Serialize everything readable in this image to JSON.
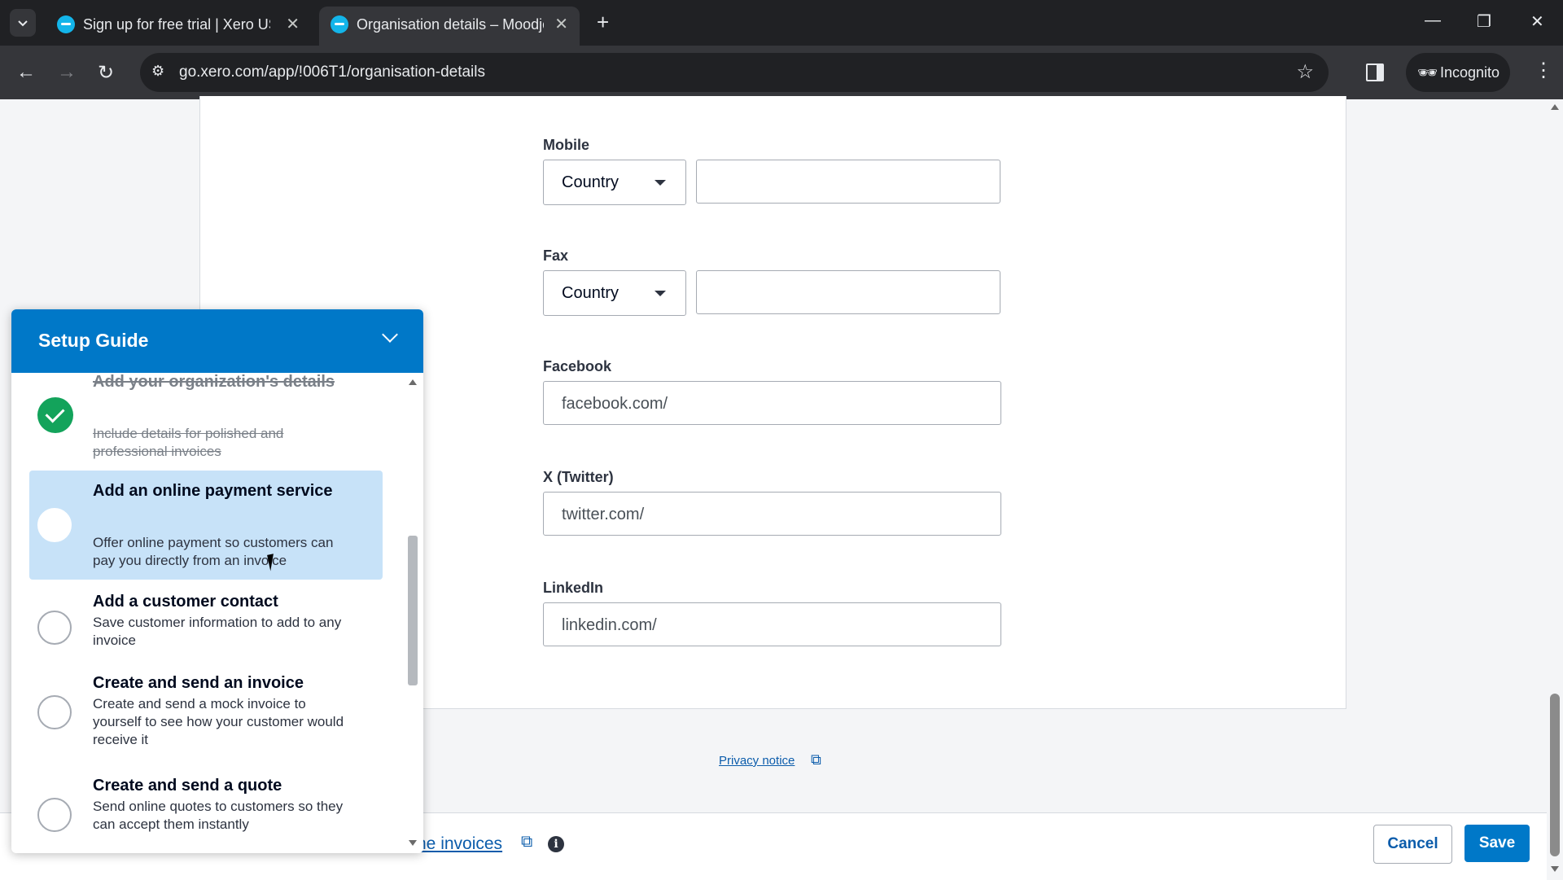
{
  "browser": {
    "tabs": [
      {
        "title": "Sign up for free trial | Xero US",
        "active": false
      },
      {
        "title": "Organisation details – Moodjoy",
        "active": true
      }
    ],
    "url": "go.xero.com/app/!006T1/organisation-details",
    "incognito_label": "Incognito"
  },
  "form": {
    "mobile": {
      "label": "Mobile",
      "country_placeholder": "Country",
      "value": ""
    },
    "fax": {
      "label": "Fax",
      "country_placeholder": "Country",
      "value": ""
    },
    "facebook": {
      "label": "Facebook",
      "value": "facebook.com/"
    },
    "twitter": {
      "label": "X (Twitter)",
      "value": "twitter.com/"
    },
    "linkedin": {
      "label": "LinkedIn",
      "value": "linkedin.com/"
    },
    "privacy_link": "Privacy notice"
  },
  "footer": {
    "online_invoices_link": "ne invoices",
    "cancel_label": "Cancel",
    "save_label": "Save"
  },
  "setup_guide": {
    "title": "Setup Guide",
    "tasks": [
      {
        "title": "Add your organization's details",
        "description": "Include details for polished and professional invoices",
        "status": "completed"
      },
      {
        "title": "Add an online payment service",
        "description": "Offer online payment so customers can pay you directly from an invoice",
        "status": "pending"
      },
      {
        "title": "Add a customer contact",
        "description": "Save customer information to add to any invoice",
        "status": "pending"
      },
      {
        "title": "Create and send an invoice",
        "description": "Create and send a mock invoice to yourself to see how your customer would receive it",
        "status": "pending"
      },
      {
        "title": "Create and send a quote",
        "description": "Send online quotes to customers so they can accept them instantly",
        "status": "pending"
      }
    ]
  },
  "colors": {
    "xero_blue": "#0078c8",
    "highlight": "#c7e2f8",
    "complete_green": "#13a35b",
    "link": "#0b5cab"
  }
}
